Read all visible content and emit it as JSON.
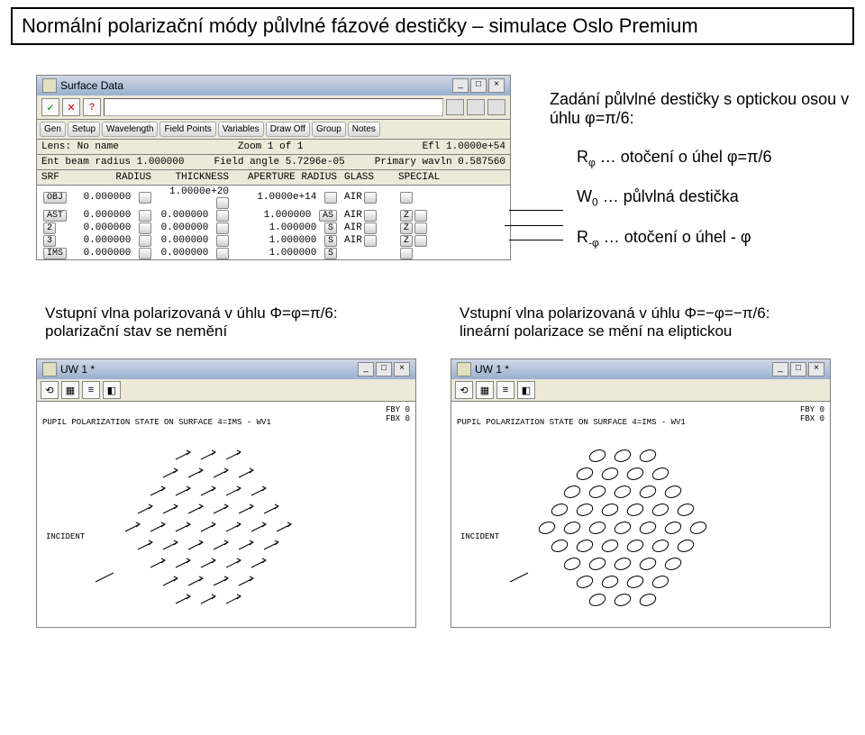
{
  "title": "Normální polarizační módy půlvlné fázové destičky  – simulace Oslo Premium",
  "surface_window": {
    "title": "Surface Data",
    "menu": [
      "Gen",
      "Setup",
      "Wavelength",
      "Field Points",
      "Variables",
      "Draw Off",
      "Group",
      "Notes"
    ],
    "lens_row": {
      "label": "Lens:",
      "value": "No name",
      "zoom": "Zoom",
      "zv": "1",
      "of": "of",
      "ofv": "1",
      "efl": "Efl",
      "eflv": "1.0000e+54"
    },
    "beam_row": {
      "label": "Ent beam radius",
      "value": "1.000000",
      "fa": "Field angle",
      "fav": "5.7296e-05",
      "pw": "Primary wavln",
      "pwv": "0.587560"
    },
    "headers": {
      "srf": "SRF",
      "rad": "RADIUS",
      "thk": "THICKNESS",
      "apr": "APERTURE RADIUS",
      "gls": "GLASS",
      "spc": "SPECIAL"
    },
    "rows": [
      {
        "srf": "OBJ",
        "rad": "0.000000",
        "thk": "1.0000e+20",
        "apr": "1.0000e+14",
        "apr_btn": "",
        "gls": "AIR",
        "spc": ""
      },
      {
        "srf": "AST",
        "rad": "0.000000",
        "thk": "0.000000",
        "apr": "1.000000",
        "apr_btn": "AS",
        "gls": "AIR",
        "spc": "Z"
      },
      {
        "srf": "2",
        "rad": "0.000000",
        "thk": "0.000000",
        "apr": "1.000000",
        "apr_btn": "S",
        "gls": "AIR",
        "spc": "Z"
      },
      {
        "srf": "3",
        "rad": "0.000000",
        "thk": "0.000000",
        "apr": "1.000000",
        "apr_btn": "S",
        "gls": "AIR",
        "spc": "Z"
      },
      {
        "srf": "IMS",
        "rad": "0.000000",
        "thk": "0.000000",
        "apr": "1.000000",
        "apr_btn": "S",
        "gls": "",
        "spc": ""
      }
    ]
  },
  "annotations": {
    "intro": "Zadání půlvlné destičky s optickou osou v úhlu φ=π/6:",
    "r1": "Rφ … otočení o úhel φ=π/6",
    "r2": "W0 … půlvlná destička",
    "r3": "R-φ … otočení o úhel - φ"
  },
  "lower_left_label": "Vstupní vlna polarizovaná v úhlu Φ=φ=π/6: polarizační stav se nemění",
  "lower_right_label": "Vstupní vlna polarizovaná v úhlu Φ=−φ=−π/6: lineární polarizace se mění na eliptickou",
  "uw": {
    "title": "UW 1 *",
    "meta_line": "PUPIL POLARIZATION STATE ON SURFACE 4=IMS - WV1",
    "fby": "FBY 0",
    "fbx": "FBX 0",
    "incident": "INCIDENT"
  }
}
